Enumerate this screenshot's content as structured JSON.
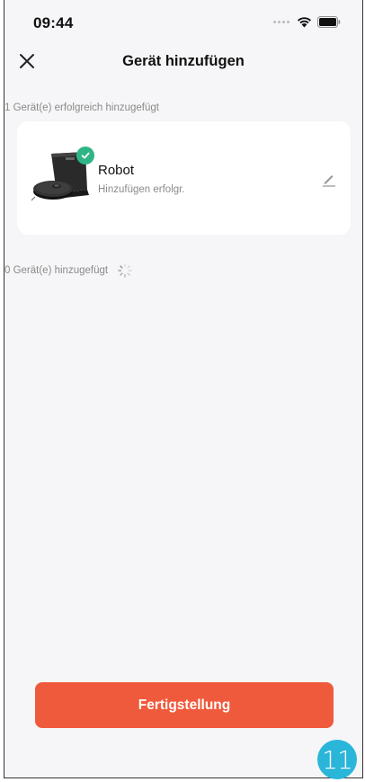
{
  "status_bar": {
    "time": "09:44",
    "icons": [
      "signal-dots-icon",
      "wifi-icon",
      "battery-icon"
    ]
  },
  "header": {
    "title": "Gerät hinzufügen",
    "close_icon": "close-icon"
  },
  "sections": {
    "success_label": "1 Gerät(e) erfolgreich hinzugefügt",
    "pending_label": "0 Gerät(e) hinzugefügt"
  },
  "device": {
    "name": "Robot",
    "status": "Hinzufügen erfolgr.",
    "image_icon": "robot-vacuum-icon",
    "badge_icon": "check-icon",
    "edit_icon": "edit-pencil-icon"
  },
  "footer": {
    "finish_label": "Fertigstellung"
  },
  "page_badge": "11",
  "colors": {
    "accent": "#f05a3c",
    "success": "#2fb585",
    "background": "#f6f6f8",
    "badge": "#2ab6d9"
  }
}
